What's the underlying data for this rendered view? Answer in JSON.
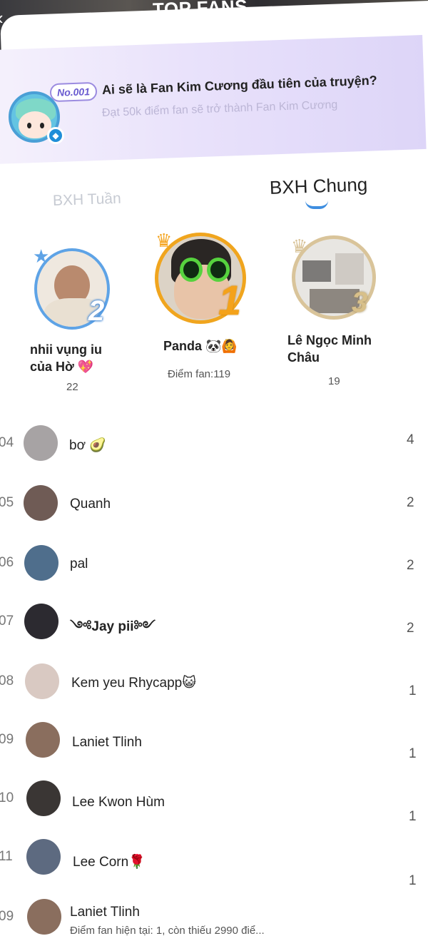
{
  "header": {
    "title": "TOP FANS",
    "back_icon": "chevron-left-icon"
  },
  "banner": {
    "badge": "No.001",
    "title": "Ai sẽ là Fan Kim Cương đầu tiên của truyện?",
    "subtitle": "Đạt 50k điểm fan sẽ trở thành Fan Kim Cương"
  },
  "tabs": {
    "weekly": "BXH Tuần",
    "general": "BXH Chung"
  },
  "podium": {
    "first": {
      "rank": "1",
      "name": "Panda 🐼🙆",
      "score": "Điểm fan:119"
    },
    "second": {
      "rank": "2",
      "name_line1": "nhii vụng iu",
      "name_line2": "của Hờ 💖",
      "score": "22"
    },
    "third": {
      "rank": "3",
      "name_line1": "Lê Ngọc Minh",
      "name_line2": "Châu",
      "score": "19"
    }
  },
  "list": [
    {
      "rank": "04",
      "name": "bơ 🥑",
      "score": "4"
    },
    {
      "rank": "05",
      "name": "Quanh",
      "score": "2"
    },
    {
      "rank": "06",
      "name": "pal",
      "score": "2"
    },
    {
      "rank": "07",
      "name": "༺Jay pii༻",
      "score": "2"
    },
    {
      "rank": "08",
      "name": "Kem yeu Rhycapp😺",
      "score": "1"
    },
    {
      "rank": "09",
      "name": "Laniet Tlinh",
      "score": "1"
    },
    {
      "rank": "10",
      "name": "Lee Kwon Hùm",
      "score": "1"
    },
    {
      "rank": "11",
      "name": "Lee Corn🌹",
      "score": "1"
    }
  ],
  "me": {
    "rank": "09",
    "name": "Laniet Tlinh",
    "status": "Điểm fan hiện tại: 1, còn thiếu 2990 điể..."
  }
}
